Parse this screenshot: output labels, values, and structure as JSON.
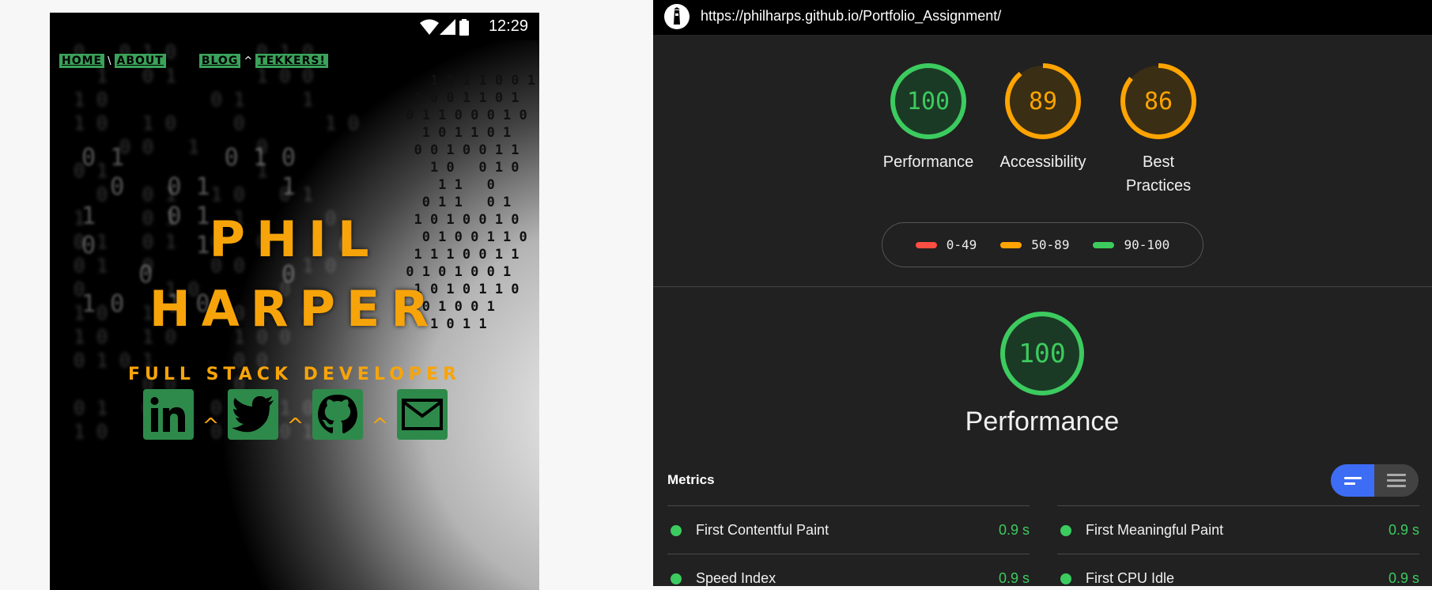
{
  "phone": {
    "status_time": "12:29",
    "nav": [
      "HOME",
      "ABOUT",
      "BLOG",
      "TEKKERS!"
    ],
    "nav_separators": [
      "\\",
      "^"
    ],
    "title_line1": "PHIL",
    "title_line2": "HARPER",
    "subtitle": "FULL STACK DEVELOPER",
    "socials": [
      "linkedin-icon",
      "twitter-icon",
      "github-icon",
      "email-icon"
    ],
    "social_separator": "^"
  },
  "report": {
    "url": "https://philharps.github.io/Portfolio_Assignment/",
    "gauges": [
      {
        "score": "100",
        "label": "Performance",
        "color": "#3ccb5f",
        "fraction": 1.0
      },
      {
        "score": "89",
        "label": "Accessibility",
        "color": "#ffa400",
        "fraction": 0.89
      },
      {
        "score": "86",
        "label_line1": "Best",
        "label_line2": "Practices",
        "color": "#ffa400",
        "fraction": 0.86
      }
    ],
    "legend": [
      {
        "range": "0-49",
        "color": "#ff4e42"
      },
      {
        "range": "50-89",
        "color": "#ffa400"
      },
      {
        "range": "90-100",
        "color": "#3ccb5f"
      }
    ],
    "main_gauge": {
      "score": "100",
      "label": "Performance",
      "fraction": 1.0
    },
    "metrics_title": "Metrics",
    "metrics": [
      {
        "name": "First Contentful Paint",
        "value": "0.9 s"
      },
      {
        "name": "First Meaningful Paint",
        "value": "0.9 s"
      },
      {
        "name": "Speed Index",
        "value": "0.9 s"
      },
      {
        "name": "First CPU Idle",
        "value": "0.9 s"
      }
    ]
  }
}
